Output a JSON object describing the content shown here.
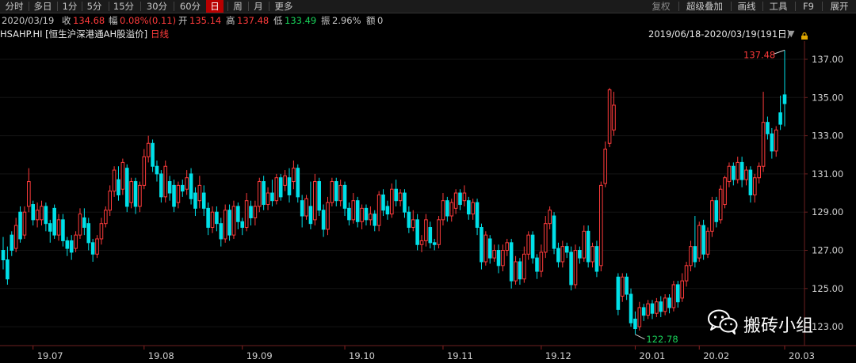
{
  "toolbar": {
    "left": [
      "分时",
      "多日",
      "1分",
      "5分",
      "15分",
      "30分",
      "60分",
      "日",
      "周",
      "月",
      "更多"
    ],
    "active": "日",
    "right": [
      "复权",
      "超级叠加",
      "画线",
      "工具",
      "F9",
      "展开"
    ]
  },
  "info": {
    "date": "2020/03/19",
    "close_label": "收",
    "close": "134.68",
    "change_label": "幅",
    "change": "0.08%(0.11)",
    "open_label": "开",
    "open": "135.14",
    "high_label": "高",
    "high": "137.48",
    "low_label": "低",
    "low": "133.49",
    "amp_label": "振",
    "amp": "2.96%",
    "volume_label": "额",
    "volume": "0"
  },
  "title": {
    "code": "HSAHP.HI [恒生沪深港通AH股溢价]",
    "period": "日线",
    "range": "2019/06/18-2020/03/19(191日)"
  },
  "chart_data": {
    "type": "candlestick",
    "ylim": [
      122.4,
      138.2
    ],
    "y_ticks": [
      "137.00",
      "135.00",
      "133.00",
      "131.00",
      "129.00",
      "127.00",
      "125.00",
      "123.00"
    ],
    "x_ticks": [
      "19.07",
      "19.08",
      "19.09",
      "19.10",
      "19.11",
      "19.12",
      "20.01",
      "20.02",
      "20.03"
    ],
    "max_label": "137.48",
    "min_label": "122.78",
    "candles": [
      [
        127.0,
        126.5,
        127.7,
        126.0
      ],
      [
        126.5,
        125.5,
        127.2,
        125.2
      ],
      [
        127.8,
        127.0,
        128.0,
        126.7
      ],
      [
        127.1,
        128.3,
        128.7,
        126.9
      ],
      [
        129.0,
        127.6,
        129.3,
        127.4
      ],
      [
        127.8,
        129.0,
        129.3,
        127.6
      ],
      [
        129.3,
        130.6,
        131.3,
        129.0
      ],
      [
        129.4,
        128.6,
        129.6,
        128.3
      ],
      [
        128.6,
        129.1,
        129.5,
        128.2
      ],
      [
        128.6,
        129.3,
        129.6,
        128.3
      ],
      [
        129.3,
        128.4,
        129.5,
        128.0
      ],
      [
        128.4,
        128.0,
        128.6,
        127.4
      ],
      [
        129.2,
        127.8,
        129.4,
        127.6
      ],
      [
        127.8,
        128.6,
        128.9,
        127.5
      ],
      [
        128.6,
        127.5,
        128.9,
        127.2
      ],
      [
        127.5,
        127.1,
        127.7,
        126.7
      ],
      [
        127.5,
        126.9,
        127.8,
        126.5
      ],
      [
        127.1,
        127.8,
        128.0,
        126.9
      ],
      [
        127.8,
        128.9,
        129.2,
        127.6
      ],
      [
        128.7,
        128.2,
        129.2,
        127.8
      ],
      [
        128.4,
        127.4,
        128.7,
        127.0
      ],
      [
        127.4,
        126.8,
        127.6,
        126.4
      ],
      [
        126.8,
        127.6,
        127.8,
        126.6
      ],
      [
        127.6,
        128.4,
        128.7,
        127.3
      ],
      [
        128.4,
        129.1,
        129.3,
        128.2
      ],
      [
        129.1,
        130.1,
        130.4,
        128.8
      ],
      [
        130.1,
        131.2,
        131.4,
        129.8
      ],
      [
        130.7,
        129.9,
        131.4,
        129.6
      ],
      [
        130.2,
        131.6,
        131.8,
        129.9
      ],
      [
        131.3,
        129.3,
        131.5,
        129.0
      ],
      [
        129.5,
        130.6,
        130.8,
        129.2
      ],
      [
        130.6,
        129.3,
        130.8,
        128.9
      ],
      [
        129.3,
        130.4,
        130.6,
        129.0
      ],
      [
        130.4,
        131.9,
        132.3,
        130.2
      ],
      [
        131.9,
        132.6,
        133.0,
        131.6
      ],
      [
        132.6,
        131.4,
        132.8,
        131.1
      ],
      [
        131.4,
        131.0,
        131.7,
        130.6
      ],
      [
        131.0,
        129.8,
        131.2,
        129.5
      ],
      [
        129.8,
        131.4,
        131.7,
        129.5
      ],
      [
        130.6,
        130.0,
        130.9,
        129.6
      ],
      [
        130.4,
        129.3,
        130.7,
        129.0
      ],
      [
        129.5,
        130.4,
        130.6,
        129.2
      ],
      [
        130.4,
        130.1,
        130.7,
        129.8
      ],
      [
        130.2,
        130.8,
        131.2,
        129.9
      ],
      [
        131.0,
        129.7,
        131.3,
        129.4
      ],
      [
        130.0,
        129.2,
        130.3,
        128.8
      ],
      [
        129.6,
        130.4,
        130.9,
        129.2
      ],
      [
        130.0,
        129.2,
        130.4,
        128.8
      ],
      [
        129.2,
        128.2,
        129.5,
        127.8
      ],
      [
        128.2,
        129.0,
        129.3,
        127.9
      ],
      [
        129.0,
        128.4,
        129.3,
        128.0
      ],
      [
        128.4,
        127.6,
        128.7,
        127.2
      ],
      [
        127.6,
        129.1,
        129.4,
        127.4
      ],
      [
        129.1,
        127.8,
        129.4,
        127.5
      ],
      [
        127.8,
        129.3,
        129.6,
        127.6
      ],
      [
        129.3,
        128.5,
        129.5,
        128.1
      ],
      [
        128.5,
        128.2,
        128.7,
        127.8
      ],
      [
        128.2,
        129.6,
        130.0,
        128.0
      ],
      [
        129.3,
        128.7,
        129.6,
        128.3
      ],
      [
        128.7,
        129.3,
        129.6,
        128.3
      ],
      [
        129.3,
        130.6,
        130.8,
        129.0
      ],
      [
        130.6,
        129.4,
        130.9,
        129.1
      ],
      [
        129.4,
        130.0,
        130.3,
        129.1
      ],
      [
        130.0,
        129.6,
        130.7,
        129.3
      ],
      [
        129.6,
        130.8,
        131.0,
        129.4
      ],
      [
        130.8,
        129.8,
        131.0,
        129.6
      ],
      [
        130.4,
        130.9,
        131.2,
        130.1
      ],
      [
        130.8,
        129.9,
        131.3,
        129.5
      ],
      [
        130.6,
        131.3,
        131.7,
        130.2
      ],
      [
        131.3,
        129.8,
        131.5,
        129.5
      ],
      [
        129.6,
        128.8,
        129.9,
        128.2
      ],
      [
        128.8,
        129.7,
        129.9,
        128.6
      ],
      [
        129.3,
        128.4,
        130.6,
        128.1
      ],
      [
        128.6,
        130.6,
        131.0,
        128.3
      ],
      [
        130.6,
        129.1,
        130.8,
        128.8
      ],
      [
        129.1,
        128.1,
        129.4,
        127.7
      ],
      [
        128.1,
        129.5,
        129.8,
        127.8
      ],
      [
        129.5,
        130.6,
        130.8,
        129.3
      ],
      [
        130.6,
        129.6,
        130.8,
        129.3
      ],
      [
        129.6,
        130.4,
        130.7,
        129.3
      ],
      [
        130.4,
        129.2,
        130.6,
        128.8
      ],
      [
        129.2,
        128.6,
        129.5,
        128.3
      ],
      [
        128.6,
        129.6,
        130.0,
        128.4
      ],
      [
        129.6,
        128.5,
        129.8,
        128.2
      ],
      [
        128.5,
        129.2,
        129.4,
        128.1
      ],
      [
        129.2,
        128.6,
        129.4,
        128.3
      ],
      [
        128.6,
        128.9,
        129.3,
        128.3
      ],
      [
        128.9,
        128.3,
        129.1,
        128.0
      ],
      [
        128.3,
        129.9,
        130.1,
        128.0
      ],
      [
        129.9,
        129.1,
        130.2,
        128.8
      ],
      [
        129.3,
        128.9,
        129.6,
        128.6
      ],
      [
        128.9,
        130.2,
        130.5,
        128.7
      ],
      [
        130.2,
        129.6,
        130.7,
        129.3
      ],
      [
        129.6,
        130.0,
        130.2,
        129.3
      ],
      [
        130.0,
        129.0,
        130.2,
        128.7
      ],
      [
        129.0,
        128.2,
        129.3,
        127.9
      ],
      [
        128.2,
        128.6,
        129.1,
        128.0
      ],
      [
        128.6,
        127.3,
        128.9,
        127.0
      ],
      [
        127.3,
        127.5,
        127.8,
        126.9
      ],
      [
        127.5,
        128.6,
        128.9,
        127.2
      ],
      [
        128.2,
        127.4,
        128.5,
        127.1
      ],
      [
        127.4,
        127.3,
        127.6,
        127.0
      ],
      [
        127.3,
        128.6,
        128.8,
        127.1
      ],
      [
        128.6,
        129.6,
        130.0,
        128.3
      ],
      [
        129.6,
        128.8,
        129.8,
        128.5
      ],
      [
        128.8,
        129.5,
        129.7,
        128.5
      ],
      [
        129.2,
        130.0,
        130.2,
        128.9
      ],
      [
        130.0,
        129.4,
        130.2,
        129.1
      ],
      [
        129.6,
        130.0,
        130.4,
        129.3
      ],
      [
        129.6,
        128.9,
        129.8,
        128.6
      ],
      [
        128.9,
        129.5,
        129.7,
        128.6
      ],
      [
        129.5,
        128.2,
        129.7,
        127.8
      ],
      [
        128.2,
        126.4,
        128.4,
        126.0
      ],
      [
        126.4,
        127.8,
        128.0,
        126.2
      ],
      [
        127.6,
        126.6,
        127.8,
        126.3
      ],
      [
        126.6,
        127.0,
        127.3,
        126.4
      ],
      [
        127.0,
        126.2,
        127.3,
        125.8
      ],
      [
        126.2,
        127.0,
        127.3,
        125.9
      ],
      [
        127.0,
        127.4,
        127.6,
        126.7
      ],
      [
        127.4,
        125.4,
        127.6,
        125.0
      ],
      [
        125.4,
        126.4,
        126.7,
        125.2
      ],
      [
        126.4,
        125.5,
        126.6,
        125.2
      ],
      [
        125.5,
        126.8,
        127.2,
        125.3
      ],
      [
        126.8,
        127.8,
        128.0,
        126.5
      ],
      [
        127.8,
        126.6,
        128.0,
        126.3
      ],
      [
        126.6,
        125.9,
        126.8,
        125.5
      ],
      [
        125.9,
        126.9,
        127.3,
        125.6
      ],
      [
        126.9,
        128.4,
        128.8,
        126.6
      ],
      [
        128.4,
        129.1,
        129.3,
        128.1
      ],
      [
        128.8,
        127.1,
        129.0,
        126.8
      ],
      [
        127.1,
        126.4,
        127.4,
        126.1
      ],
      [
        126.4,
        127.2,
        127.5,
        126.1
      ],
      [
        127.2,
        126.9,
        127.4,
        126.6
      ],
      [
        126.9,
        125.2,
        127.2,
        124.9
      ],
      [
        125.2,
        127.0,
        127.3,
        125.0
      ],
      [
        127.0,
        126.6,
        127.2,
        126.3
      ],
      [
        126.6,
        128.0,
        128.3,
        126.4
      ],
      [
        128.0,
        126.4,
        128.3,
        126.1
      ],
      [
        126.4,
        127.2,
        127.4,
        126.1
      ],
      [
        127.2,
        125.9,
        127.5,
        125.6
      ],
      [
        126.2,
        130.4,
        130.6,
        125.9
      ],
      [
        130.5,
        132.3,
        132.7,
        130.3
      ],
      [
        132.6,
        135.4,
        135.5,
        132.4
      ],
      [
        133.3,
        134.6,
        135.3,
        133.0
      ],
      [
        125.6,
        123.9,
        125.8,
        123.6
      ],
      [
        124.6,
        125.6,
        125.8,
        124.3
      ],
      [
        125.6,
        124.7,
        125.8,
        124.4
      ],
      [
        124.7,
        123.2,
        125.0,
        123.0
      ],
      [
        123.4,
        122.9,
        123.8,
        122.6
      ],
      [
        123.0,
        124.0,
        124.3,
        122.8
      ],
      [
        124.0,
        123.6,
        124.2,
        123.3
      ],
      [
        123.6,
        124.2,
        124.4,
        123.4
      ],
      [
        124.2,
        123.7,
        124.4,
        123.4
      ],
      [
        123.7,
        124.3,
        124.5,
        123.5
      ],
      [
        124.3,
        123.8,
        124.6,
        123.5
      ],
      [
        123.8,
        124.5,
        124.7,
        123.6
      ],
      [
        124.5,
        124.0,
        124.7,
        123.7
      ],
      [
        124.0,
        125.2,
        125.4,
        123.8
      ],
      [
        125.2,
        124.3,
        125.4,
        124.0
      ],
      [
        124.5,
        125.4,
        125.8,
        124.3
      ],
      [
        125.4,
        126.2,
        126.4,
        125.1
      ],
      [
        126.2,
        127.2,
        127.5,
        125.9
      ],
      [
        127.2,
        126.4,
        128.8,
        126.1
      ],
      [
        126.6,
        128.3,
        128.5,
        126.4
      ],
      [
        128.3,
        126.8,
        128.6,
        126.5
      ],
      [
        126.8,
        128.0,
        128.2,
        126.6
      ],
      [
        128.0,
        129.6,
        129.8,
        127.7
      ],
      [
        129.6,
        128.5,
        129.8,
        128.2
      ],
      [
        128.6,
        130.2,
        130.4,
        128.4
      ],
      [
        129.4,
        130.8,
        130.9,
        129.2
      ],
      [
        130.6,
        131.4,
        131.6,
        130.3
      ],
      [
        131.4,
        130.7,
        131.6,
        130.4
      ],
      [
        130.7,
        131.6,
        131.9,
        130.5
      ],
      [
        131.6,
        130.7,
        131.9,
        130.3
      ],
      [
        130.7,
        131.2,
        131.4,
        130.4
      ],
      [
        131.2,
        129.9,
        131.4,
        129.5
      ],
      [
        129.9,
        130.8,
        131.0,
        129.5
      ],
      [
        130.8,
        131.4,
        131.6,
        130.5
      ],
      [
        131.4,
        133.7,
        135.3,
        131.1
      ],
      [
        133.7,
        133.1,
        134.0,
        132.8
      ],
      [
        133.1,
        132.2,
        133.4,
        131.8
      ],
      [
        132.2,
        133.3,
        133.5,
        131.9
      ],
      [
        134.2,
        133.6,
        135.1,
        133.3
      ],
      [
        135.14,
        134.68,
        137.48,
        133.49
      ]
    ]
  },
  "watermark": {
    "icon": "wechat-icon",
    "text": "搬砖小组"
  },
  "colors": {
    "up": "#ff3b3b",
    "down": "#00e0e8",
    "grid": "#141414",
    "axis": "#6b2020",
    "max_label": "#ff3b3b",
    "min_label": "#19d35a"
  }
}
